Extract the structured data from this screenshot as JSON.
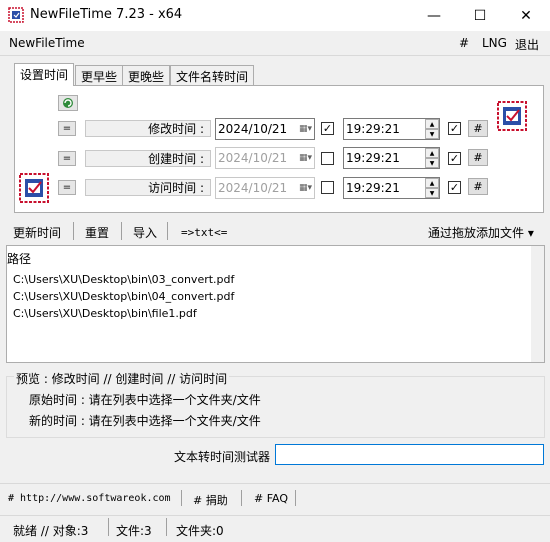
{
  "window": {
    "title": "NewFileTime 7.23 - x64",
    "minimize_glyph": "—",
    "maximize_glyph": "☐",
    "close_glyph": "✕"
  },
  "menubar": {
    "left_label": "NewFileTime",
    "right_items": [
      "#",
      "LNG",
      "退出"
    ]
  },
  "tabs": [
    "设置时间",
    "更早些",
    "更晚些",
    "文件名转时间"
  ],
  "time_rows": [
    {
      "eq": "=",
      "label": "修改时间 :",
      "date": "2024/10/21",
      "date_enabled": true,
      "date_checked": true,
      "time": "19:29:21",
      "time_checked": true,
      "hash": "#"
    },
    {
      "eq": "=",
      "label": "创建时间 :",
      "date": "2024/10/21",
      "date_enabled": false,
      "date_checked": false,
      "time": "19:29:21",
      "time_checked": true,
      "hash": "#"
    },
    {
      "eq": "=",
      "label": "访问时间 :",
      "date": "2024/10/21",
      "date_enabled": false,
      "date_checked": false,
      "time": "19:29:21",
      "time_checked": true,
      "hash": "#"
    }
  ],
  "toolbar": {
    "update": "更新时间",
    "reset": "重置",
    "import": "导入",
    "txt": "=>txt<=",
    "drag_add": "通过拖放添加文件 ▾"
  },
  "file_list": {
    "header": "路径",
    "rows": [
      "C:\\Users\\XU\\Desktop\\bin\\03_convert.pdf",
      "C:\\Users\\XU\\Desktop\\bin\\04_convert.pdf",
      "C:\\Users\\XU\\Desktop\\bin\\file1.pdf"
    ]
  },
  "preview": {
    "title": "预览 :   修改时间    //   创建时间    //   访问时间",
    "original": "原始时间 : 请在列表中选择一个文件夹/文件",
    "new": "新的时间 : 请在列表中选择一个文件夹/文件"
  },
  "tester": {
    "label": "文本转时间测试器",
    "value": ""
  },
  "links": [
    "# http://www.softwareok.com",
    "# 捐助",
    "# FAQ"
  ],
  "status": [
    "就绪 // 对象:3",
    "文件:3",
    "文件夹:0"
  ],
  "colors": {
    "accent": "#0078d7",
    "icon_red": "#c8102e",
    "icon_blue": "#2b4fa8",
    "icon_green": "#2e8b3a"
  },
  "icons": [
    "app-icon",
    "calendar-stamp-icon",
    "refresh-icon",
    "calendar-dropdown-icon"
  ]
}
